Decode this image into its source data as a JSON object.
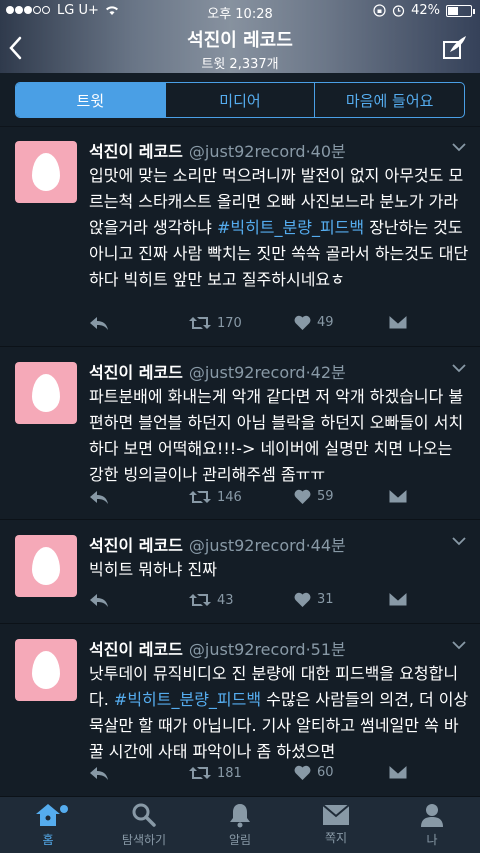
{
  "status": {
    "carrier": "LG U+",
    "time": "오후 10:28",
    "battery": "42%"
  },
  "header": {
    "title": "석진이 레코드",
    "subtitle": "트윗 2,337개"
  },
  "segments": [
    "트윗",
    "미디어",
    "마음에 들어요"
  ],
  "tweets": [
    {
      "name": "석진이 레코드",
      "handle": "@just92record",
      "time": "40분",
      "text_before": "입맛에 맞는 소리만 먹으려니까 발전이 없지 아무것도 모르는척 스타캐스트 올리면 오빠 사진보느라 분노가 가라앉을거라 생각하냐 ",
      "hashtag": "#빅히트_분량_피드백",
      "text_after": " 장난하는 것도 아니고 진짜 사람 빡치는 짓만 쏙쏙 골라서 하는것도 대단하다 빅히트 앞만 보고 질주하시네요ㅎ",
      "retweets": "170",
      "likes": "49"
    },
    {
      "name": "석진이 레코드",
      "handle": "@just92record",
      "time": "42분",
      "text_before": "파트분배에 화내는게 악개 같다면 저 악개 하겠습니다 불편하면 블언블 하던지 아님 블락을 하던지 오빠들이 서치하다 보면 어떡해요!!!-> 네이버에 실명만 치면 나오는 강한 빙의글이나 관리해주셈 좀ㅠㅠ",
      "hashtag": "",
      "text_after": "",
      "retweets": "146",
      "likes": "59"
    },
    {
      "name": "석진이 레코드",
      "handle": "@just92record",
      "time": "44분",
      "text_before": "빅히트 뭐하냐 진짜",
      "hashtag": "",
      "text_after": "",
      "retweets": "43",
      "likes": "31"
    },
    {
      "name": "석진이 레코드",
      "handle": "@just92record",
      "time": "51분",
      "text_before": "낫투데이 뮤직비디오 진 분량에 대한 피드백을 요청합니다. ",
      "hashtag": "#빅히트_분량_피드백",
      "text_after": " 수많은 사람들의 의견, 더 이상 묵살만 할 때가 아닙니다. 기사 알티하고 썸네일만 쏙 바꿀 시간에 사태 파악이나 좀 하셨으면",
      "retweets": "181",
      "likes": "60"
    }
  ],
  "tabbar": [
    "홈",
    "탐색하기",
    "알림",
    "쪽지",
    "나"
  ],
  "colors": {
    "accent": "#55acee",
    "background": "#141d26",
    "muted": "#8899a6",
    "avatar": "#f5a9b8"
  }
}
